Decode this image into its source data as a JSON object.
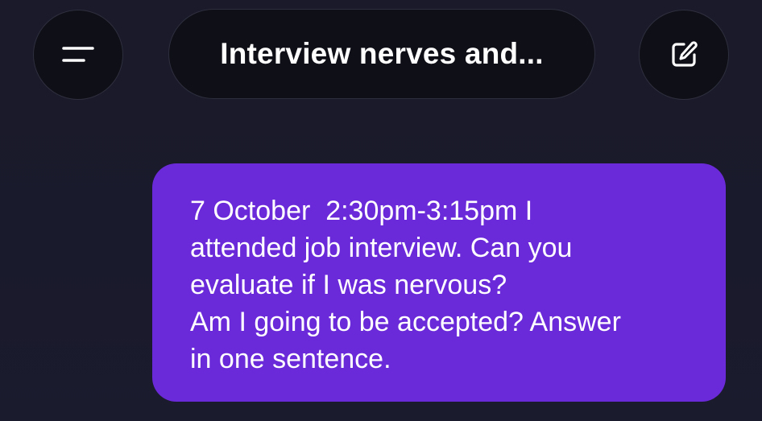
{
  "header": {
    "menu_icon": "menu-icon",
    "title": "Interview nerves and...",
    "compose_icon": "compose-icon"
  },
  "message": {
    "lines": [
      "7 October  2:30pm-3:15pm I",
      "attended job interview. Can you",
      "evaluate if I was nervous?",
      "Am I going to be accepted? Answer",
      "in one sentence."
    ]
  },
  "colors": {
    "background": "#1a1a2a",
    "pill": "#0f0f17",
    "bubble": "#6b2ad9",
    "text": "#ffffff"
  }
}
